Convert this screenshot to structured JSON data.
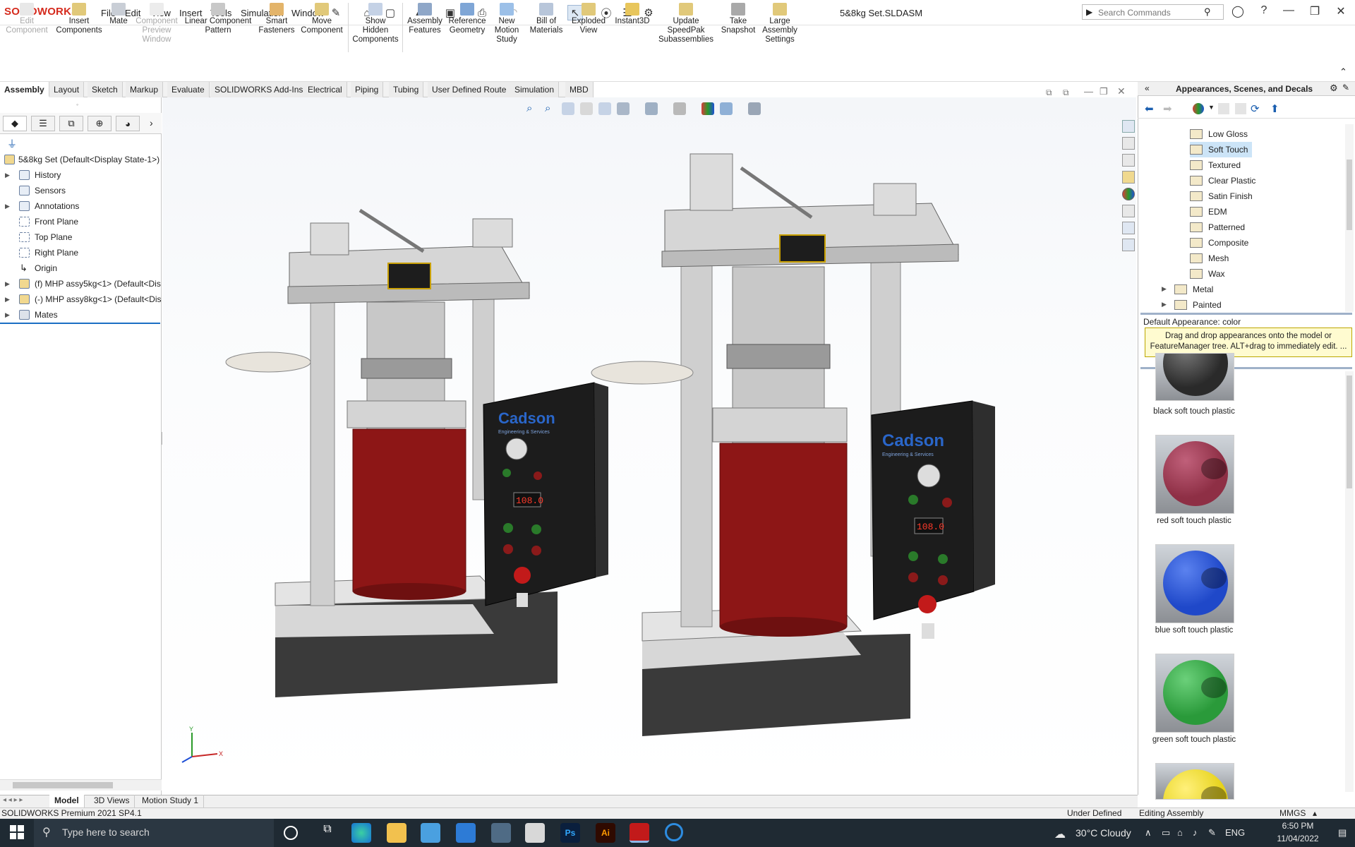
{
  "app": {
    "logo": "SOLIDWORKS",
    "document_title": "5&8kg Set.SLDASM"
  },
  "menu": [
    "File",
    "Edit",
    "View",
    "Insert",
    "Tools",
    "Simulation",
    "Window"
  ],
  "search": {
    "placeholder": "Search Commands"
  },
  "commands": [
    {
      "label": "Edit Component",
      "enabled": false
    },
    {
      "label": "Insert Components",
      "enabled": true
    },
    {
      "label": "Mate",
      "enabled": true
    },
    {
      "label": "Component Preview Window",
      "enabled": false
    },
    {
      "label": "Linear Component Pattern",
      "enabled": true
    },
    {
      "label": "Smart Fasteners",
      "enabled": true
    },
    {
      "label": "Move Component",
      "enabled": true
    },
    {
      "label": "Show Hidden Components",
      "enabled": true
    },
    {
      "label": "Assembly Features",
      "enabled": true
    },
    {
      "label": "Reference Geometry",
      "enabled": true
    },
    {
      "label": "New Motion Study",
      "enabled": true
    },
    {
      "label": "Bill of Materials",
      "enabled": true
    },
    {
      "label": "Exploded View",
      "enabled": true
    },
    {
      "label": "Instant3D",
      "enabled": true
    },
    {
      "label": "Update SpeedPak Subassemblies",
      "enabled": true
    },
    {
      "label": "Take Snapshot",
      "enabled": true
    },
    {
      "label": "Large Assembly Settings",
      "enabled": true
    }
  ],
  "tabs": [
    "Assembly",
    "Layout",
    "Sketch",
    "Markup",
    "Evaluate",
    "SOLIDWORKS Add-Ins",
    "Electrical",
    "Piping",
    "Tubing",
    "User Defined Route",
    "Simulation",
    "MBD"
  ],
  "active_tab": "Assembly",
  "feature_tree": {
    "root": "5&8kg Set  (Default<Display State-1>)",
    "items": [
      {
        "label": "History",
        "expandable": true
      },
      {
        "label": "Sensors",
        "expandable": false
      },
      {
        "label": "Annotations",
        "expandable": true
      },
      {
        "label": "Front Plane",
        "expandable": false
      },
      {
        "label": "Top Plane",
        "expandable": false
      },
      {
        "label": "Right Plane",
        "expandable": false
      },
      {
        "label": "Origin",
        "expandable": false
      },
      {
        "label": "(f) MHP assy5kg<1> (Default<Dis",
        "expandable": true
      },
      {
        "label": "(-) MHP assy8kg<1> (Default<Dis",
        "expandable": true
      },
      {
        "label": "Mates",
        "expandable": true
      }
    ]
  },
  "model": {
    "brand": "Cadson",
    "tagline": "Engineering & Services",
    "display_left": "108.0",
    "display_right": "108.0",
    "triad": {
      "x": "X",
      "y": "Y"
    }
  },
  "appearances_panel": {
    "title": "Appearances, Scenes, and Decals",
    "folders": [
      "Low Gloss",
      "Soft Touch",
      "Textured",
      "Clear Plastic",
      "Satin Finish",
      "EDM",
      "Patterned",
      "Composite",
      "Mesh",
      "Wax"
    ],
    "selected_folder": "Soft Touch",
    "top_folders": [
      "Metal",
      "Painted"
    ],
    "default_appearance": "Default Appearance: color",
    "tip": "Drag and drop appearances onto the model or FeatureManager tree.  ALT+drag to immediately edit. ...",
    "swatches": [
      {
        "label": "black soft touch plastic",
        "color": "#2a2a2a"
      },
      {
        "label": "red soft touch plastic",
        "color": "#8e2f45"
      },
      {
        "label": "blue soft touch plastic",
        "color": "#1f48c9"
      },
      {
        "label": "green soft touch plastic",
        "color": "#2a9a3a"
      },
      {
        "label": "",
        "color": "#e6d21a"
      }
    ]
  },
  "bottom_tabs": [
    "Model",
    "3D Views",
    "Motion Study 1"
  ],
  "status": {
    "product": "SOLIDWORKS Premium 2021 SP4.1",
    "definition": "Under Defined",
    "mode": "Editing Assembly",
    "units": "MMGS"
  },
  "taskbar": {
    "search_placeholder": "Type here to search",
    "weather": "30°C  Cloudy",
    "language": "ENG",
    "time": "6:50 PM",
    "date": "11/04/2022"
  },
  "colors": {
    "accent": "#d52b1e",
    "tip_bg": "#fffbd0",
    "selection": "#cce4f7",
    "taskbar": "#1f2a33"
  }
}
